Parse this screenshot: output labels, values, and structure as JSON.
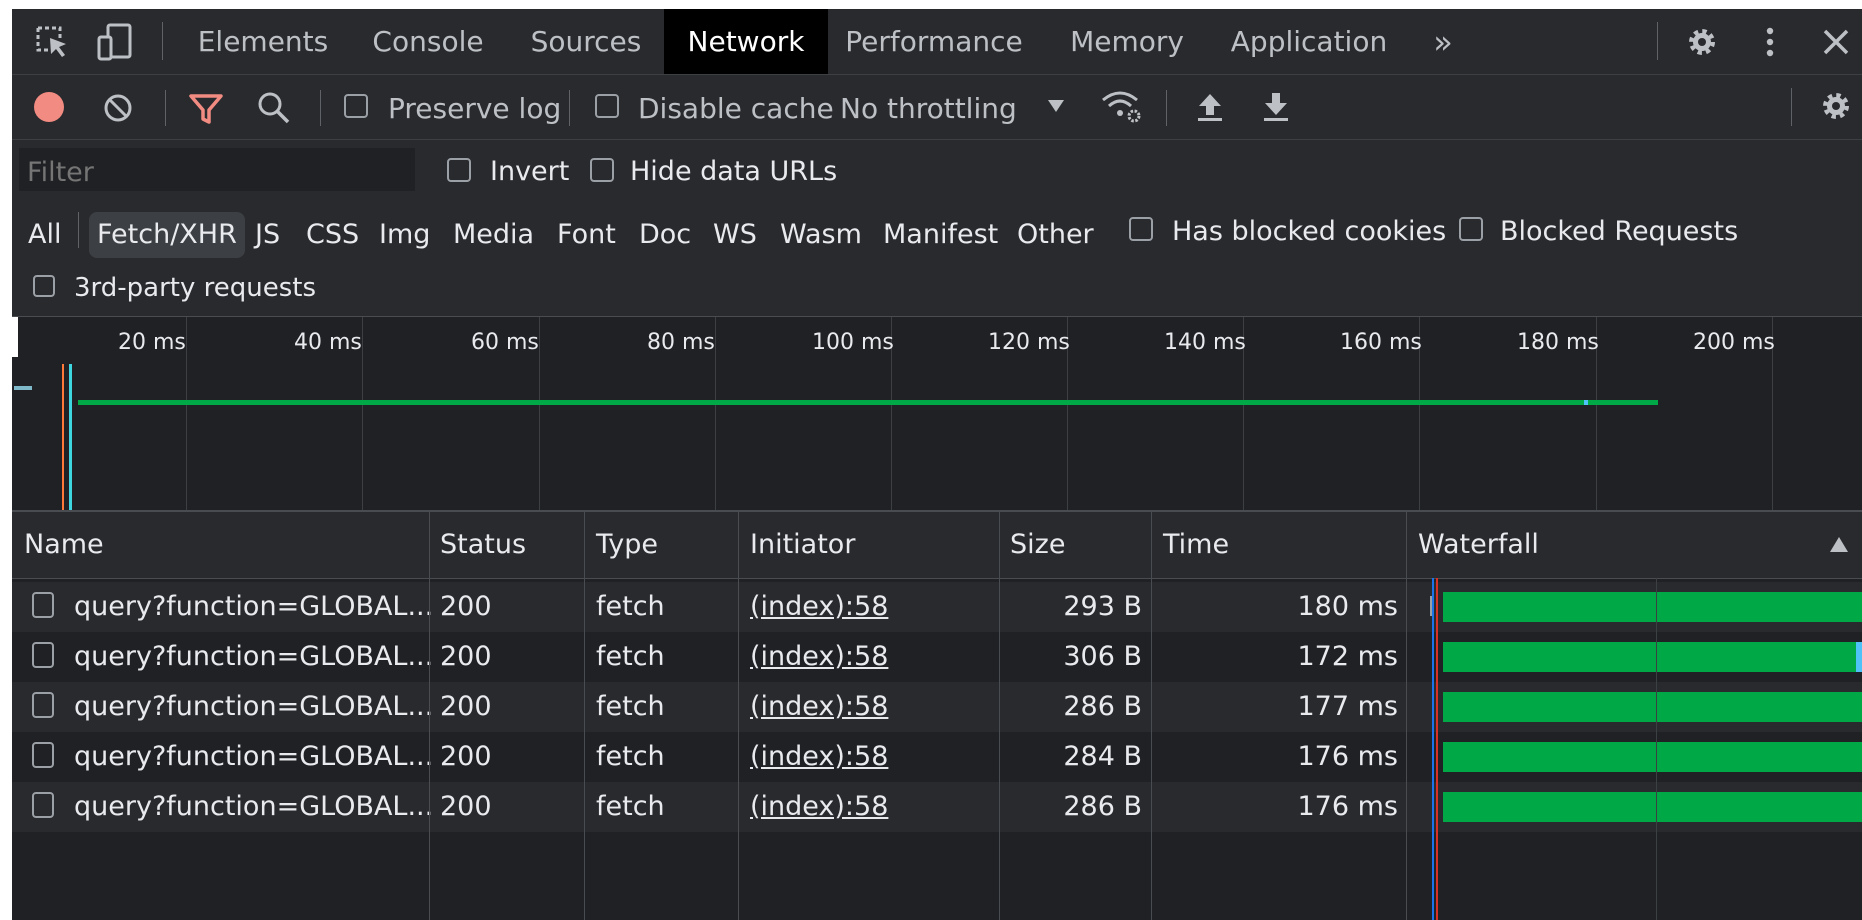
{
  "tabs": {
    "elements": "Elements",
    "console": "Console",
    "sources": "Sources",
    "network": "Network",
    "performance": "Performance",
    "memory": "Memory",
    "application": "Application",
    "more": "»"
  },
  "toolbar": {
    "preserve_log": "Preserve log",
    "disable_cache": "Disable cache",
    "throttling": "No throttling"
  },
  "filter": {
    "placeholder": "Filter",
    "invert": "Invert",
    "hide_data_urls": "Hide data URLs",
    "types": [
      "All",
      "Fetch/XHR",
      "JS",
      "CSS",
      "Img",
      "Media",
      "Font",
      "Doc",
      "WS",
      "Wasm",
      "Manifest",
      "Other"
    ],
    "active_type": "Fetch/XHR",
    "has_blocked_cookies": "Has blocked cookies",
    "blocked_requests": "Blocked Requests",
    "third_party": "3rd-party requests"
  },
  "overview": {
    "ticks": [
      "20 ms",
      "40 ms",
      "60 ms",
      "80 ms",
      "100 ms",
      "120 ms",
      "140 ms",
      "160 ms",
      "180 ms",
      "200 ms"
    ]
  },
  "table": {
    "headers": {
      "name": "Name",
      "status": "Status",
      "type": "Type",
      "initiator": "Initiator",
      "size": "Size",
      "time": "Time",
      "waterfall": "Waterfall"
    },
    "rows": [
      {
        "name": "query?function=GLOBAL...",
        "status": "200",
        "type": "fetch",
        "initiator": "(index):58",
        "size": "293 B",
        "time": "180 ms"
      },
      {
        "name": "query?function=GLOBAL...",
        "status": "200",
        "type": "fetch",
        "initiator": "(index):58",
        "size": "306 B",
        "time": "172 ms"
      },
      {
        "name": "query?function=GLOBAL...",
        "status": "200",
        "type": "fetch",
        "initiator": "(index):58",
        "size": "286 B",
        "time": "177 ms"
      },
      {
        "name": "query?function=GLOBAL...",
        "status": "200",
        "type": "fetch",
        "initiator": "(index):58",
        "size": "284 B",
        "time": "176 ms"
      },
      {
        "name": "query?function=GLOBAL...",
        "status": "200",
        "type": "fetch",
        "initiator": "(index):58",
        "size": "286 B",
        "time": "176 ms"
      }
    ]
  },
  "colors": {
    "record": "#f28b82",
    "filter_active": "#f28b82",
    "waterfall_bar": "#00a846",
    "selected_tab_bg": "#000000"
  },
  "icons": [
    "inspect-element-icon",
    "device-toolbar-icon",
    "settings-icon",
    "kebab-menu-icon",
    "close-icon",
    "record-icon",
    "clear-icon",
    "filter-icon",
    "search-icon",
    "network-conditions-icon",
    "import-har-icon",
    "export-har-icon",
    "sort-ascending-icon"
  ]
}
